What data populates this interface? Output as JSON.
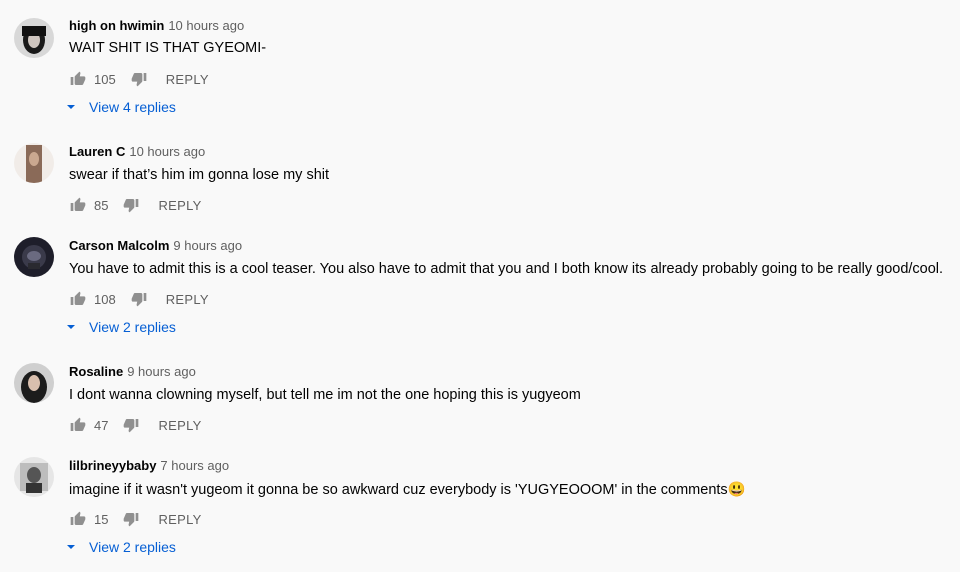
{
  "comments": [
    {
      "author": "high on hwimin",
      "time": "10 hours ago",
      "text": "WAIT SHIT IS THAT GYEOMI-",
      "likes": "105",
      "reply_label": "REPLY",
      "view_replies": "View 4 replies"
    },
    {
      "author": "Lauren C",
      "time": "10 hours ago",
      "text": "swear if that’s him im gonna lose my shit",
      "likes": "85",
      "reply_label": "REPLY"
    },
    {
      "author": "Carson Malcolm",
      "time": "9 hours ago",
      "text": "You have to admit this is a cool teaser. You also have to admit that you and I both know its already probably going to be really good/cool.",
      "likes": "108",
      "reply_label": "REPLY",
      "view_replies": "View 2 replies"
    },
    {
      "author": "Rosaline",
      "time": "9 hours ago",
      "text": "I dont wanna clowning myself, but tell me im not the one hoping this is yugyeom",
      "likes": "47",
      "reply_label": "REPLY"
    },
    {
      "author": "lilbrineyybaby",
      "time": "7 hours ago",
      "text": "imagine if it wasn't yugeom it gonna be so awkward cuz everybody is 'YUGYEOOOM' in the comments😃",
      "likes": "15",
      "reply_label": "REPLY",
      "view_replies": "View 2 replies"
    }
  ],
  "icons": {
    "like": "thumbs-up-icon",
    "dislike": "thumbs-down-icon",
    "expand": "caret-down-icon"
  },
  "colors": {
    "background": "#f9f9f9",
    "link_blue": "#065fd4",
    "icon_gray": "#909090",
    "meta_gray": "#606060"
  }
}
